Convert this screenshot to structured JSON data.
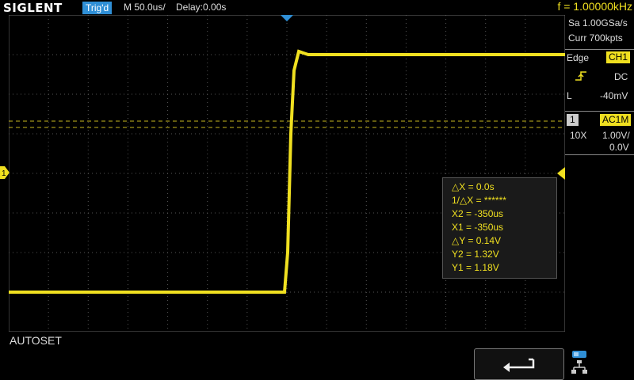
{
  "header": {
    "brand": "SIGLENT",
    "trig_status": "Trig'd",
    "timebase": "M 50.0us/",
    "delay": "Delay:0.00s",
    "frequency": "f = 1.00000kHz"
  },
  "acq": {
    "sample_rate": "Sa 1.00GSa/s",
    "memory": "Curr 700kpts"
  },
  "trigger": {
    "type_label": "Edge",
    "source": "CH1",
    "coupling": "DC",
    "level_label": "L",
    "level_value": "-40mV"
  },
  "channel1": {
    "number": "1",
    "coupling": "AC1M",
    "probe": "10X",
    "volts_div": "1.00V/",
    "offset": "0.0V"
  },
  "measurements": [
    "△X = 0.0s",
    "1/△X = ******",
    "X2 = -350us",
    "X1 = -350us",
    "△Y = 0.14V",
    "Y2 = 1.32V",
    "Y1 = 1.18V"
  ],
  "ground_marker": "1",
  "footer": {
    "menu_label": "AUTOSET"
  },
  "colors": {
    "trace": "#f0e020",
    "accent": "#2f8fd6"
  },
  "icons": {
    "back": "back-arrow-icon",
    "network": "network-icon",
    "usb": "usb-icon"
  }
}
